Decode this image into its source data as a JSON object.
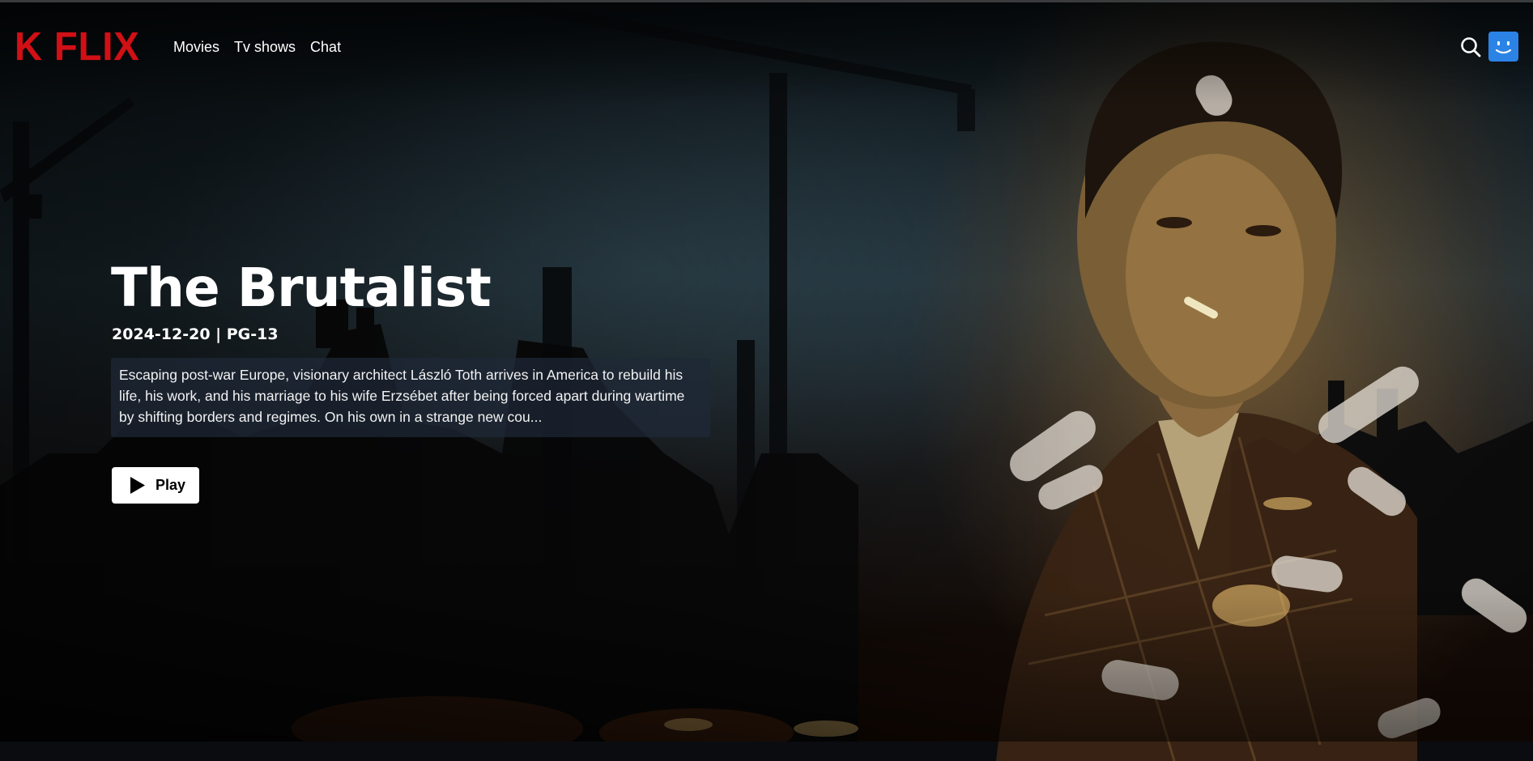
{
  "app": {
    "logo_text": "K FLIX"
  },
  "nav": {
    "links": [
      {
        "label": "Movies"
      },
      {
        "label": "Tv shows"
      },
      {
        "label": "Chat"
      }
    ],
    "search_icon": "search-icon",
    "avatar_icon": "smiley-face-icon"
  },
  "hero": {
    "title": "The Brutalist",
    "meta": "2024-12-20 | PG-13",
    "overview": "Escaping post-war Europe, visionary architect László Toth arrives in America to rebuild his life, his work, and his marriage to his wife Erzsébet after being forced apart during wartime by shifting borders and regimes. On his own in a strange new cou...",
    "play_label": "Play",
    "play_icon": "play-icon"
  },
  "colors": {
    "brand": "#d11016",
    "avatar": "#2b83e6",
    "button_bg": "#ffffff"
  }
}
